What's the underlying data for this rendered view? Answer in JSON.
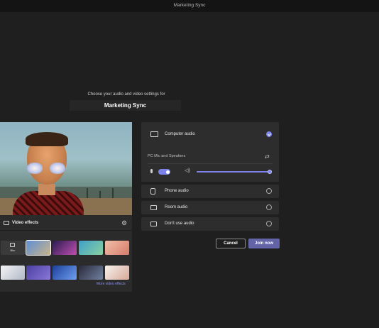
{
  "window": {
    "title": "Marketing Sync"
  },
  "prejoin": {
    "heading": "Choose your audio and video settings for",
    "meeting_name": "Marketing Sync"
  },
  "video_effects": {
    "label": "Video effects",
    "blur_label": "Blur",
    "more_link": "More video effects",
    "backgrounds": [
      {
        "name": "blur",
        "selected": false
      },
      {
        "name": "beach-sunset",
        "colors": [
          "#5f8fd6",
          "#c9b48a"
        ],
        "selected": true
      },
      {
        "name": "bokeh-lights",
        "colors": [
          "#2a1c50",
          "#c04fb0"
        ]
      },
      {
        "name": "tropical-sky",
        "colors": [
          "#3fa0c8",
          "#8ad0a0"
        ]
      },
      {
        "name": "pink-room",
        "colors": [
          "#f0c0a8",
          "#d67a6a"
        ]
      },
      {
        "name": "white-studio",
        "colors": [
          "#f4f4f4",
          "#b0b8c8"
        ]
      },
      {
        "name": "purple-gradient",
        "colors": [
          "#4a3fa0",
          "#8a78d8"
        ]
      },
      {
        "name": "blue-wave",
        "colors": [
          "#1d3f9a",
          "#6fa0f0"
        ]
      },
      {
        "name": "dark-grid",
        "colors": [
          "#2a2a3a",
          "#7080a0"
        ]
      },
      {
        "name": "bright-loft",
        "colors": [
          "#f6f2ee",
          "#d8a898"
        ]
      }
    ]
  },
  "audio": {
    "computer_audio": {
      "label": "Computer audio",
      "selected": true
    },
    "device": "PC Mic and Speakers",
    "mic_on": true,
    "speaker_volume": 1.0,
    "phone_audio": {
      "label": "Phone audio",
      "selected": false
    },
    "room_audio": {
      "label": "Room audio",
      "selected": false
    },
    "no_audio": {
      "label": "Don't use audio",
      "selected": false
    }
  },
  "buttons": {
    "cancel": "Cancel",
    "join": "Join now"
  },
  "colors": {
    "accent": "#7b83eb",
    "join_button": "#6264a7",
    "background": "#1f1f1f",
    "panel": "#2d2d2d"
  }
}
